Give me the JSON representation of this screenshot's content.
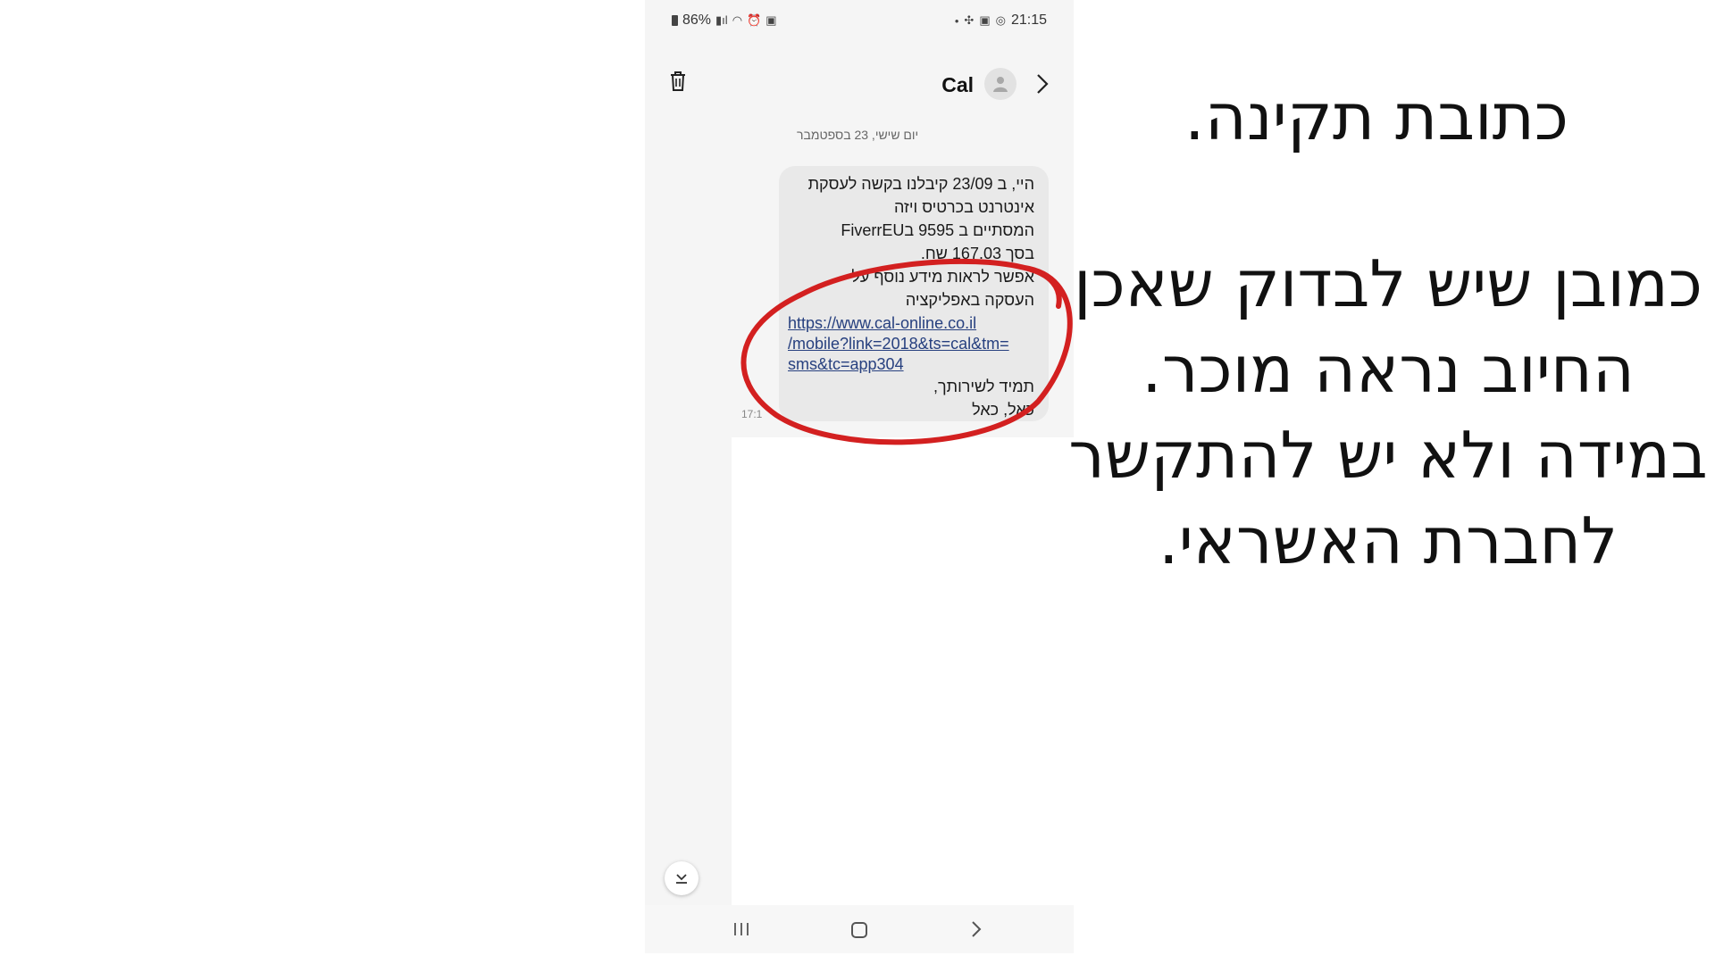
{
  "status_bar": {
    "battery": "86%",
    "time": "21:15"
  },
  "header": {
    "contact_name": "Cal"
  },
  "conversation": {
    "date_divider": "יום שישי, 23 בספטמבר",
    "message_lines": [
      "היי, ב 23/09 קיבלנו בקשה לעסקת",
      "אינטרנט בכרטיס ויזה",
      "המסתיים ב 9595 בFiverrEU",
      "בסך 167.03 שח.",
      "אפשר לראות מידע נוסף על",
      "העסקה באפליקציה"
    ],
    "link_lines": [
      "https://www.cal-online.co.il",
      "/mobile?link=2018&ts=cal&tm=",
      "sms&tc=app304"
    ],
    "closing_lines": [
      "תמיד לשירותך,",
      "כאל, כאל"
    ],
    "time": "17:1"
  },
  "annotation": {
    "title": "כתובת תקינה.",
    "body": "כמובן שיש לבדוק שאכן החיוב נראה מוכר. במידה ולא יש להתקשר לחברת האשראי.",
    "circle_color": "#d32020"
  },
  "icons": {
    "delete": "trash-icon",
    "avatar": "person-icon",
    "open": "chevron-right-icon",
    "scroll": "scroll-to-bottom-icon",
    "nav_recents": "recents-icon",
    "nav_home": "home-icon",
    "nav_back": "back-icon"
  }
}
